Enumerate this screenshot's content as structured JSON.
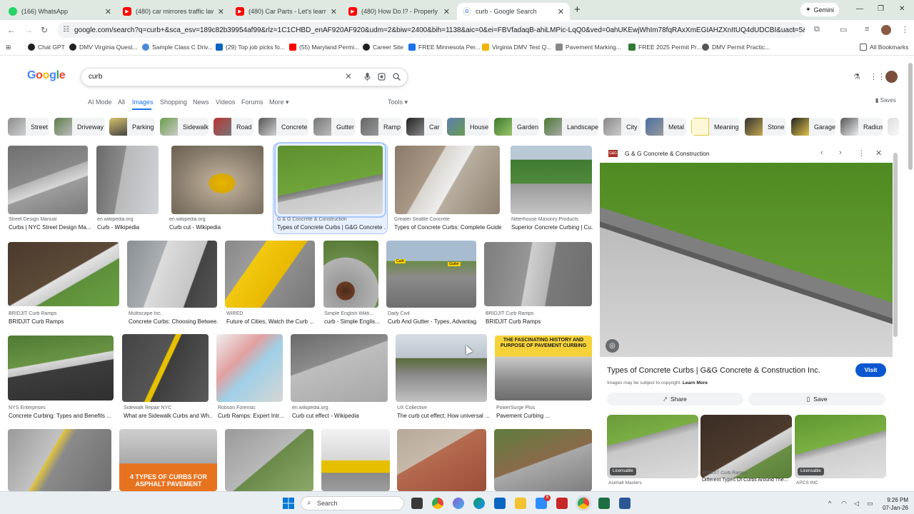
{
  "browser": {
    "tabs": [
      {
        "title": "(166) WhatsApp",
        "icon": "whatsapp-icon",
        "color": "#25d366"
      },
      {
        "title": "(480) car mirrores traffic laws - ",
        "icon": "youtube-icon",
        "color": "#ff0000"
      },
      {
        "title": "(480) Car Parts - Let's learn and ",
        "icon": "youtube-icon",
        "color": "#ff0000"
      },
      {
        "title": "(480) How Do I? - Properly Use",
        "icon": "youtube-icon",
        "color": "#ff0000"
      },
      {
        "title": "curb - Google Search",
        "icon": "google-icon",
        "color": "#4285f4"
      }
    ],
    "gemini_label": "Gemini",
    "url": "google.com/search?q=curb+&sca_esv=189c82b39954af99&rlz=1C1CHBD_enAF920AF920&udm=2&biw=2400&bih=1138&aic=0&ei=FBVfadaqB-ahiLMPic-LqQ0&ved=0ahUKEwjWhIm78fqRAxXmEGIAHZXnItUQ4dUDCBI&uact=5&oq...",
    "bookmarks": [
      {
        "label": "Chat GPT",
        "color": "#202124"
      },
      {
        "label": "DMV Virginia Quest...",
        "color": "#202124"
      },
      {
        "label": "Sample Class C Driv...",
        "color": "#4a8ad8"
      },
      {
        "label": "(29) Top job picks fo...",
        "color": "#0a66c2"
      },
      {
        "label": "(55) Maryland Permi...",
        "color": "#ff0000"
      },
      {
        "label": "Career Site",
        "color": "#202124"
      },
      {
        "label": "FREE Minnesota Per...",
        "color": "#1a73e8"
      },
      {
        "label": "Virginia DMV Test Q...",
        "color": "#f2b400"
      },
      {
        "label": "Pavement Marking...",
        "color": "#666666"
      },
      {
        "label": "FREE 2025 Permit Pr...",
        "color": "#2e7d32"
      },
      {
        "label": "DMV Permit Practic...",
        "color": "#555555"
      }
    ],
    "all_bookmarks": "All Bookmarks"
  },
  "google": {
    "logo": "Google",
    "query": "curb",
    "nav_tabs": [
      "AI Mode",
      "All",
      "Images",
      "Shopping",
      "News",
      "Videos",
      "Forums",
      "More",
      "Tools"
    ],
    "active_tab": "Images",
    "saves": "Saves",
    "chips": [
      "Street",
      "Driveway",
      "Parking",
      "Sidewalk",
      "Road",
      "Concrete",
      "Gutter",
      "Ramp",
      "Car",
      "House",
      "Garden",
      "Landscape",
      "City",
      "Metal",
      "Meaning",
      "Stone",
      "Garage",
      "Radius"
    ]
  },
  "results": [
    {
      "source": "Street Design Manual",
      "caption": "Curbs | NYC Street Design Ma..."
    },
    {
      "source": "en.wikipedia.org",
      "caption": "Curb - Wikipedia"
    },
    {
      "source": "en.wikipedia.org",
      "caption": "Curb cut - Wikipedia"
    },
    {
      "source": "G & G Concrete & Construction",
      "caption": "Types of Concrete Curbs | G&G Concrete ..."
    },
    {
      "source": "Greater Seattle Concrete",
      "caption": "Types of Concrete Curbs: Complete Guide ..."
    },
    {
      "source": "Nitterhouse Masonry Products",
      "caption": "Superior Concrete Curbing | Cu..."
    },
    {
      "source": "BRIDJIT Curb Ramps",
      "caption": "BRIDJIT Curb Ramps"
    },
    {
      "source": "Multiscape Inc.",
      "caption": "Concrete Curbs: Choosing Betwee..."
    },
    {
      "source": "WIRED",
      "caption": "Future of Cities, Watch the Curb ..."
    },
    {
      "source": "Simple English Wikti...",
      "caption": "curb - Simple Englis..."
    },
    {
      "source": "Daily Civil",
      "caption": "Curb And Gutter - Types, Advantag..."
    },
    {
      "source": "BRIDJIT Curb Ramps",
      "caption": "BRIDJIT Curb Ramps"
    },
    {
      "source": "NYS Enterprises",
      "caption": "Concrete Curbing: Types and Benefits ..."
    },
    {
      "source": "Sidewalk Repair NYC",
      "caption": "What are Sidewalk Curbs and Wh..."
    },
    {
      "source": "Robson Forensic",
      "caption": "Curb Ramps: Expert Intr..."
    },
    {
      "source": "en.wikipedia.org",
      "caption": "Curb cut effect - Wikipedia"
    },
    {
      "source": "UX Collective",
      "caption": "The curb cut effect: How universal ..."
    },
    {
      "source": "PowerSurge Plus",
      "caption": "Pavement Curbing ..."
    }
  ],
  "image_text": {
    "daily_civil_curb": "Curb",
    "daily_civil_gutter": "Gutter",
    "fascinating": "THE FASCINATING HISTORY AND PURPOSE OF PAVEMENT CURBING",
    "types_of_curbs": "4 TYPES OF CURBS FOR ASPHALT PAVEMENT"
  },
  "panel": {
    "site": "G & G Concrete & Construction",
    "site_logo": "G&G",
    "title": "Types of Concrete Curbs | G&G Concrete & Construction Inc.",
    "visit": "Visit",
    "copyright": "Images may be subject to copyright.",
    "learn_more": "Learn More",
    "share": "Share",
    "save": "Save",
    "licensable": "Licensable",
    "related": [
      {
        "source": "Asphalt Masters",
        "caption": ""
      },
      {
        "source": "BRIDJIT Curb Ramps",
        "caption": "Different Types Of Curbs Around The..."
      },
      {
        "source": "APCS INC",
        "caption": ""
      }
    ]
  },
  "taskbar": {
    "search": "Search",
    "time": "9:26 PM",
    "date": "07-Jan-26",
    "badge": "6"
  }
}
